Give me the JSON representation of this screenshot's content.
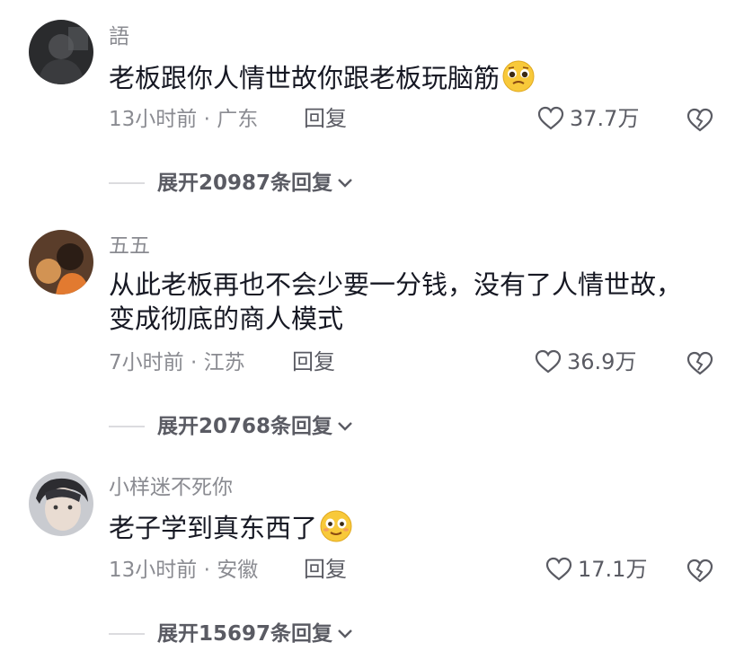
{
  "comments": [
    {
      "username": "語",
      "text": "老板跟你人情世故你跟老板玩脑筋",
      "emoji": "pleading-face-emoji",
      "time": "13小时前",
      "location": "广东",
      "reply_label": "回复",
      "likes": "37.7万",
      "expand_label": "展开20987条回复"
    },
    {
      "username": "五五",
      "text": "从此老板再也不会少要一分钱，没有了人情世故，\n变成彻底的商人模式",
      "emoji": "",
      "time": "7小时前",
      "location": "江苏",
      "reply_label": "回复",
      "likes": "36.9万",
      "expand_label": "展开20768条回复"
    },
    {
      "username": "小样迷不死你",
      "text": "老子学到真东西了",
      "emoji": "astonished-face-emoji",
      "time": "13小时前",
      "location": "安徽",
      "reply_label": "回复",
      "likes": "17.1万",
      "expand_label": "展开15697条回复"
    }
  ],
  "meta_separator": " · ",
  "colors": {
    "text_primary": "#161823",
    "text_secondary": "#8a8b91",
    "action": "#5a5b63",
    "divider": "#dcdcdf",
    "emoji_yellow": "#f8c93a"
  },
  "icons": {
    "like": "heart-outline-icon",
    "dislike": "broken-heart-icon",
    "expand": "chevron-down-icon"
  }
}
